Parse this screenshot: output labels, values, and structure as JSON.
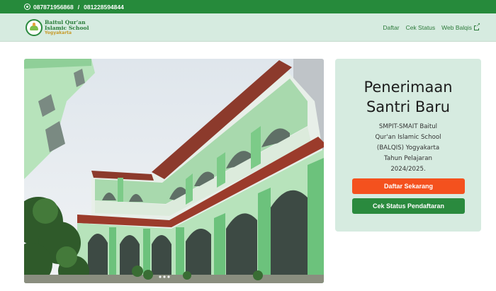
{
  "topbar": {
    "phone_1": "087871956868",
    "separator": "/",
    "phone_2": "081228594844",
    "icon": "whatsapp-icon"
  },
  "navbar": {
    "brand_name_line1": "Baitul Qur'an",
    "brand_name_line2": "Islamic School",
    "brand_city": "Yogyakarta",
    "links": [
      "Daftar",
      "Cek Status",
      "Web Balqis"
    ],
    "external_icon": "external-link-icon"
  },
  "hero": {
    "image_alt": "school-building-photo"
  },
  "card": {
    "title_line1": "Penerimaan",
    "title_line2": "Santri Baru",
    "subtitle_line1": "SMPIT-SMAIT Baitul",
    "subtitle_line2": "Qur'an Islamic School",
    "subtitle_line3": "(BALQIS) Yogyakarta",
    "subtitle_line4": "Tahun Pelajaran",
    "subtitle_line5": "2024/2025.",
    "btn_daftar": "Daftar Sekarang",
    "btn_cek": "Cek Status Pendaftaran"
  },
  "colors": {
    "primary_green": "#268a3b",
    "nav_bg": "#d6ebe0",
    "accent_orange": "#f4511e",
    "building_green": "#9ed6a5"
  }
}
